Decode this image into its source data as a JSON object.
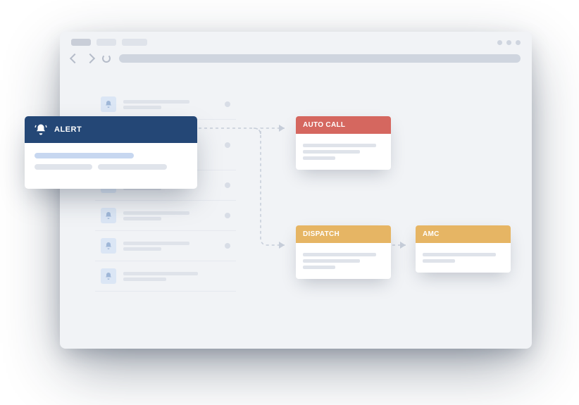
{
  "alert_popout": {
    "title": "ALERT"
  },
  "flow_cards": {
    "auto_call": {
      "title": "AUTO CALL"
    },
    "dispatch": {
      "title": "DISPATCH"
    },
    "amc": {
      "title": "AMC"
    }
  }
}
